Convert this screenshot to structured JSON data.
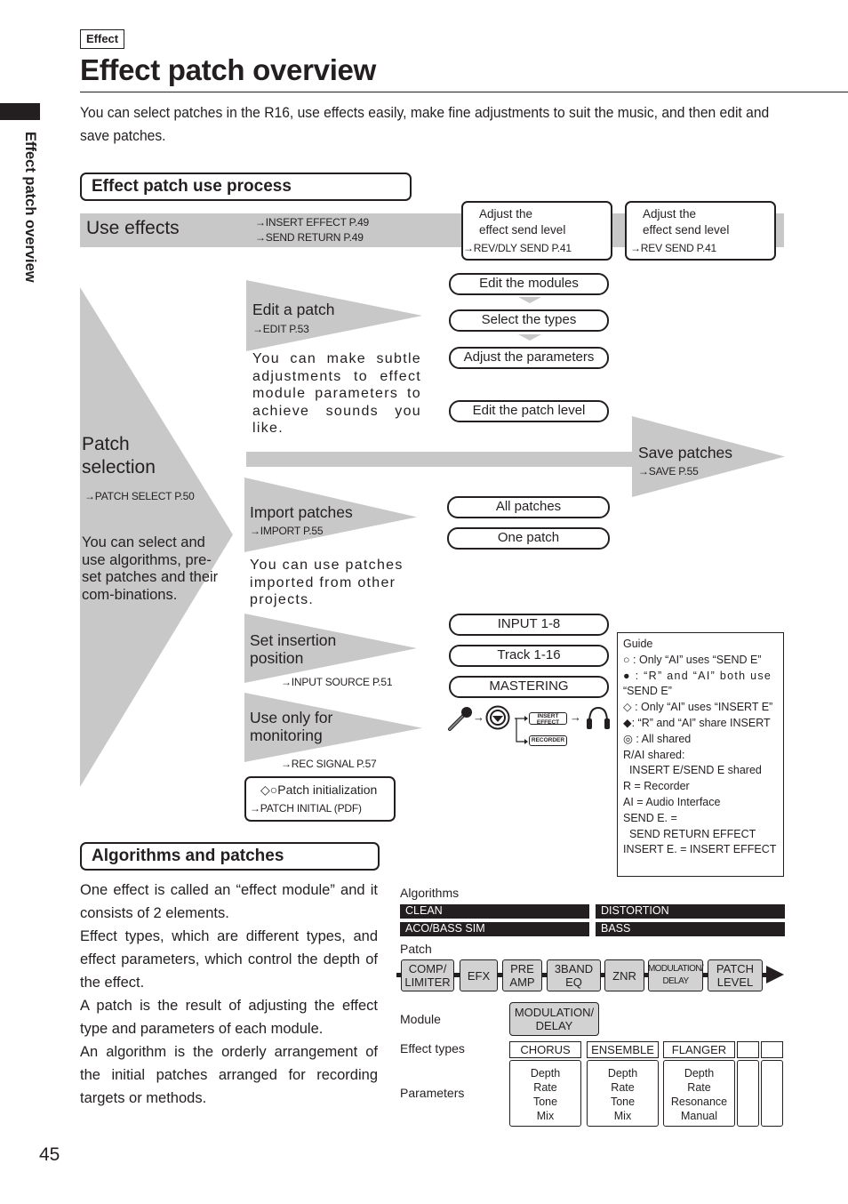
{
  "header": {
    "category_tag": "Effect",
    "title": "Effect patch overview",
    "side_tab": "Effect patch overview",
    "intro": "You can select patches in the R16, use effects easily, make fine adjustments to suit the music, and then edit and save patches."
  },
  "process": {
    "section_title": "Effect patch use process",
    "use_effects": {
      "label": "Use effects",
      "refs": [
        "→INSERT EFFECT P.49",
        "→SEND RETURN P.49"
      ],
      "boxes": [
        {
          "line1": "Adjust the",
          "line2": "effect send level",
          "ref": "→REV/DLY SEND P.41"
        },
        {
          "line1": "Adjust the",
          "line2": "effect send level",
          "ref": "→REV SEND P.41"
        }
      ]
    },
    "patch_selection": {
      "label_line1": "Patch",
      "label_line2": "selection",
      "ref": "→PATCH SELECT P.50",
      "description": "You can select and use algorithms, pre-set patches and their com-binations."
    },
    "edit_patch": {
      "label": "Edit a patch",
      "ref": "→EDIT P.53",
      "description": "You can make subtle adjustments to effect module parameters to achieve sounds you like.",
      "steps": [
        "Edit the modules",
        "Select the types",
        "Adjust the parameters",
        "Edit the patch level"
      ]
    },
    "save_patches": {
      "label": "Save patches",
      "ref": "→SAVE P.55"
    },
    "import_patches": {
      "label": "Import patches",
      "ref": "→IMPORT P.55",
      "description": "You can use patches imported from other projects.",
      "options": [
        "All patches",
        "One patch"
      ]
    },
    "insertion": {
      "label_line1": "Set insertion",
      "label_line2": "position",
      "ref": "→INPUT SOURCE P.51",
      "options": [
        "INPUT 1-8",
        "Track 1-16",
        "MASTERING"
      ]
    },
    "monitoring": {
      "label_line1": "Use only for",
      "label_line2": "monitoring",
      "ref": "→REC SIGNAL P.57",
      "flow": {
        "insert_label_1": "INSERT",
        "insert_label_2": "EFFECT",
        "recorder_label": "RECORDER"
      }
    },
    "patch_init": {
      "symbols": "◇○",
      "label": "Patch initialization",
      "ref": "→PATCH INITIAL (PDF)"
    },
    "guide": {
      "title": "Guide",
      "lines": [
        "○ : Only “AI” uses “SEND E”",
        "● : “R” and “AI” both use",
        "“SEND E”",
        "◇ : Only “AI” uses “INSERT E”",
        "◆: “R” and “AI” share INSERT",
        "◎ : All shared",
        "R/AI shared:",
        "  INSERT E/SEND E shared",
        "R = Recorder",
        "AI = Audio Interface",
        "SEND E. =",
        "  SEND RETURN EFFECT",
        "INSERT E. = INSERT EFFECT"
      ]
    }
  },
  "algorithms": {
    "section_title": "Algorithms and patches",
    "paragraphs": [
      "One effect is called an “effect module” and it consists of 2 elements.",
      "Effect types, which are different types, and effect parameters, which control the depth of the effect.",
      "A patch is the result of adjusting the effect type and parameters of each module.",
      "An algorithm is the orderly arrangement of the initial patches arranged for recording targets or methods."
    ],
    "diagram": {
      "algorithms_label": "Algorithms",
      "algorithm_names": [
        "CLEAN",
        "DISTORTION",
        "ACO/BASS SIM",
        "BASS"
      ],
      "patch_label": "Patch",
      "modules": [
        {
          "l1": "COMP/",
          "l2": "LIMITER"
        },
        {
          "l1": "EFX",
          "l2": ""
        },
        {
          "l1": "PRE",
          "l2": "AMP"
        },
        {
          "l1": "3BAND",
          "l2": "EQ"
        },
        {
          "l1": "ZNR",
          "l2": ""
        },
        {
          "l1": "MODULATION/",
          "l2": "DELAY"
        },
        {
          "l1": "PATCH",
          "l2": "LEVEL"
        }
      ],
      "module_label": "Module",
      "selected_module": {
        "l1": "MODULATION/",
        "l2": "DELAY"
      },
      "effect_types_label": "Effect types",
      "effect_types": [
        "CHORUS",
        "ENSEMBLE",
        "FLANGER"
      ],
      "parameters_label": "Parameters",
      "parameters": [
        [
          "Depth",
          "Rate",
          "Tone",
          "Mix"
        ],
        [
          "Depth",
          "Rate",
          "Tone",
          "Mix"
        ],
        [
          "Depth",
          "Rate",
          "Resonance",
          "Manual"
        ]
      ]
    }
  },
  "footer": {
    "page_number": "45"
  }
}
